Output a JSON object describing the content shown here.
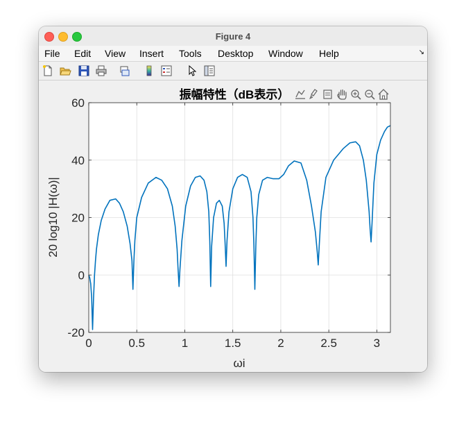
{
  "window": {
    "title": "Figure 4"
  },
  "menu": {
    "items": [
      "File",
      "Edit",
      "View",
      "Insert",
      "Tools",
      "Desktop",
      "Window",
      "Help"
    ],
    "more_icon": "arrow-down-right-icon"
  },
  "toolbar": {
    "icons": [
      "new-figure-icon",
      "open-file-icon",
      "save-icon",
      "print-icon",
      "link-icon",
      "colorbar-icon",
      "legend-icon",
      "pointer-icon",
      "property-inspector-icon"
    ]
  },
  "axes_toolbar": {
    "icons": [
      "export-icon",
      "brush-icon",
      "data-tips-icon",
      "pan-icon",
      "zoom-in-icon",
      "zoom-out-icon",
      "home-icon"
    ]
  },
  "colors": {
    "line": "#0072bd",
    "grid": "#dfdfdf",
    "axes_bg": "#ffffff",
    "figure_bg": "#f0f0f0"
  },
  "chart_data": {
    "type": "line",
    "title": "振幅特性（dB表示）",
    "xlabel": "ωi",
    "ylabel": "20 log10 |H(ω)|",
    "xlim": [
      0,
      3.1416
    ],
    "ylim": [
      -20,
      60
    ],
    "xticks": [
      0,
      0.5,
      1,
      1.5,
      2,
      2.5,
      3
    ],
    "xtick_labels": [
      "0",
      "0.5",
      "1",
      "1.5",
      "2",
      "2.5",
      "3"
    ],
    "yticks": [
      -20,
      0,
      20,
      40,
      60
    ],
    "ytick_labels": [
      "-20",
      "0",
      "20",
      "40",
      "60"
    ],
    "grid": true,
    "series": [
      {
        "x": [
          0.0,
          0.01,
          0.02,
          0.03,
          0.04,
          0.05,
          0.06,
          0.07,
          0.08,
          0.1,
          0.13,
          0.17,
          0.22,
          0.28,
          0.32,
          0.36,
          0.4,
          0.43,
          0.45,
          0.46,
          0.47,
          0.48,
          0.5,
          0.55,
          0.62,
          0.7,
          0.76,
          0.82,
          0.87,
          0.9,
          0.92,
          0.93,
          0.94,
          0.95,
          0.97,
          1.01,
          1.06,
          1.11,
          1.16,
          1.2,
          1.23,
          1.25,
          1.26,
          1.27,
          1.28,
          1.3,
          1.33,
          1.36,
          1.39,
          1.41,
          1.42,
          1.43,
          1.44,
          1.46,
          1.5,
          1.55,
          1.6,
          1.65,
          1.69,
          1.71,
          1.72,
          1.73,
          1.74,
          1.75,
          1.77,
          1.81,
          1.86,
          1.92,
          1.98,
          2.03,
          2.08,
          2.14,
          2.21,
          2.27,
          2.32,
          2.36,
          2.38,
          2.39,
          2.4,
          2.42,
          2.47,
          2.55,
          2.65,
          2.72,
          2.78,
          2.82,
          2.86,
          2.89,
          2.92,
          2.93,
          2.94,
          2.95,
          2.97,
          3.0,
          3.04,
          3.08,
          3.11,
          3.14
        ],
        "y": [
          0,
          -1,
          -3,
          -8,
          -19,
          -8,
          0,
          5,
          9,
          14,
          19,
          23,
          26,
          26.5,
          25,
          22,
          17,
          11,
          5,
          -5,
          5,
          12,
          20,
          27,
          32,
          34,
          33,
          30,
          24,
          17,
          9,
          2,
          -4,
          2,
          12,
          24,
          31,
          34,
          34.5,
          33,
          29,
          22,
          12,
          -4,
          10,
          20,
          25,
          26,
          24,
          18,
          11,
          3,
          12,
          22,
          30,
          34,
          35,
          34,
          29,
          20,
          10,
          -5,
          10,
          20,
          28,
          33,
          34,
          33.5,
          33.5,
          35,
          38,
          39.7,
          39,
          33,
          24,
          15,
          8,
          3.5,
          10,
          22,
          34,
          40,
          44,
          46,
          46.4,
          45,
          40,
          33,
          22,
          16,
          11.5,
          18,
          32,
          42,
          47,
          50,
          51.5,
          52
        ]
      }
    ]
  }
}
